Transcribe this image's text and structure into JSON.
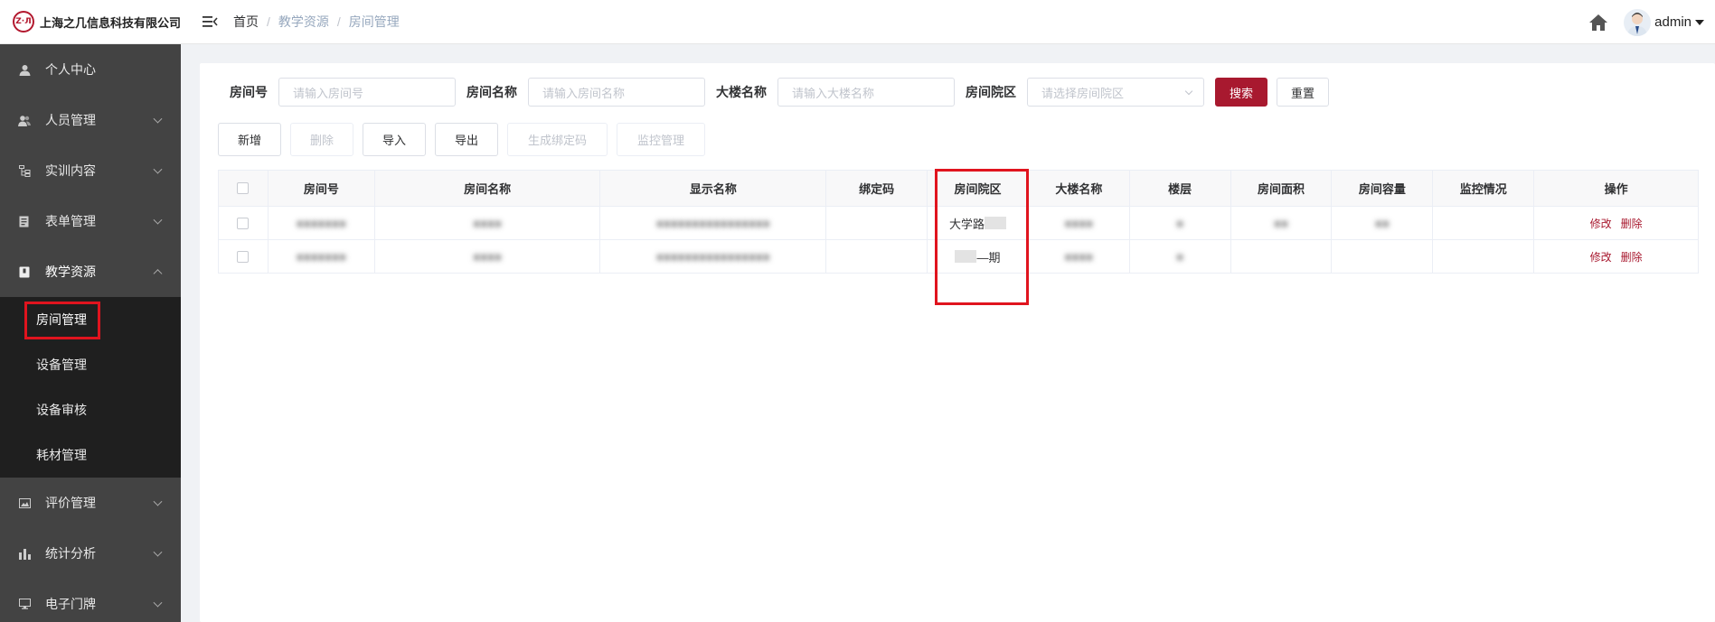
{
  "company": {
    "logo_mark": "Z·Л",
    "name": "上海之几信息科技有限公司"
  },
  "breadcrumb": [
    "首页",
    "教学资源",
    "房间管理"
  ],
  "user": {
    "name": "admin"
  },
  "sidebar": {
    "items": [
      {
        "label": "个人中心",
        "icon": "user-icon",
        "expandable": false
      },
      {
        "label": "人员管理",
        "icon": "people-icon",
        "expandable": true
      },
      {
        "label": "实训内容",
        "icon": "tree-icon",
        "expandable": true
      },
      {
        "label": "表单管理",
        "icon": "form-icon",
        "expandable": true
      },
      {
        "label": "教学资源",
        "icon": "book-icon",
        "expandable": true,
        "expanded": true
      },
      {
        "label": "评价管理",
        "icon": "image-icon",
        "expandable": true
      },
      {
        "label": "统计分析",
        "icon": "bar-chart-icon",
        "expandable": true
      },
      {
        "label": "电子门牌",
        "icon": "monitor-icon",
        "expandable": true
      }
    ],
    "submenu": [
      "房间管理",
      "设备管理",
      "设备审核",
      "耗材管理"
    ],
    "active_sub": "房间管理"
  },
  "filters": [
    {
      "label": "房间号",
      "placeholder": "请输入房间号"
    },
    {
      "label": "房间名称",
      "placeholder": "请输入房间名称"
    },
    {
      "label": "大楼名称",
      "placeholder": "请输入大楼名称"
    },
    {
      "label": "房间院区",
      "placeholder": "请选择房间院区",
      "type": "select"
    }
  ],
  "search_buttons": {
    "search": "搜索",
    "reset": "重置"
  },
  "toolbar": [
    {
      "label": "新增",
      "disabled": false
    },
    {
      "label": "删除",
      "disabled": true
    },
    {
      "label": "导入",
      "disabled": false
    },
    {
      "label": "导出",
      "disabled": false
    },
    {
      "label": "生成绑定码",
      "disabled": true
    },
    {
      "label": "监控管理",
      "disabled": true
    }
  ],
  "table": {
    "columns": [
      "",
      "房间号",
      "房间名称",
      "显示名称",
      "绑定码",
      "房间院区",
      "大楼名称",
      "楼层",
      "房间面积",
      "房间容量",
      "监控情况",
      "操作"
    ],
    "rows": [
      {
        "campus_visible": "大学路",
        "actions": [
          "修改",
          "删除"
        ]
      },
      {
        "campus_visible": "—期",
        "actions": [
          "修改",
          "删除"
        ]
      }
    ]
  },
  "colors": {
    "accent": "#a8192f",
    "sidebar_bg": "#434343",
    "submenu_bg": "#1f1f1f",
    "highlight": "#e0141e"
  }
}
